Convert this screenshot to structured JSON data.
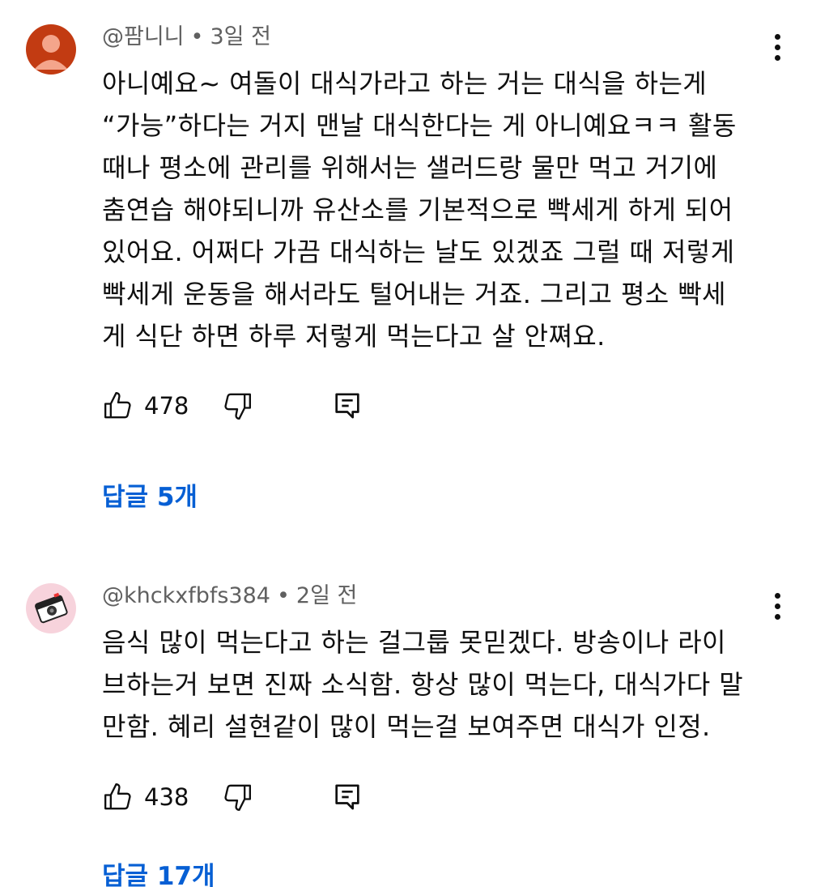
{
  "comments": [
    {
      "author": "@팜니니",
      "time": "3일 전",
      "text": "아니예요~ 여돌이 대식가라고 하는 거는 대식을 하는게\n“가능”하다는 거지 맨날 대식한다는 게 아니예요ㅋㅋ 활동\n때나 평소에 관리를 위해서는 샐러드랑 물만 먹고 거기에\n춤연습 해야되니까 유산소를 기본적으로 빡세게 하게 되어\n있어요. 어쩌다 가끔 대식하는 날도 있겠죠 그럴 때 저렇게\n빡세게 운동을 해서라도 털어내는 거죠. 그리고 평소 빡세\n게 식단 하면 하루 저렇게 먹는다고 살 안쪄요.",
      "likes": "478",
      "replies": "답글 5개",
      "avatar_color": "#c23b12",
      "icons": {
        "like": "thumbs-up-icon",
        "dislike": "thumbs-down-icon",
        "reply": "reply-comment-icon",
        "more": "more-vertical-icon"
      }
    },
    {
      "author": "@khckxfbfs384",
      "time": "2일 전",
      "text": "음식 많이 먹는다고 하는 걸그룹 못믿겠다. 방송이나 라이\n브하는거 보면 진짜 소식함. 항상 많이 먹는다, 대식가다 말\n만함. 혜리 설현같이 많이 먹는걸 보여주면 대식가 인정.",
      "likes": "438",
      "replies": "답글 17개",
      "avatar_color": "#f7d3dc",
      "icons": {
        "like": "thumbs-up-icon",
        "dislike": "thumbs-down-icon",
        "reply": "reply-comment-icon",
        "more": "more-vertical-icon"
      }
    }
  ],
  "separator": "•",
  "colors": {
    "link": "#065fd4",
    "meta": "#606060",
    "text": "#0f0f0f"
  }
}
